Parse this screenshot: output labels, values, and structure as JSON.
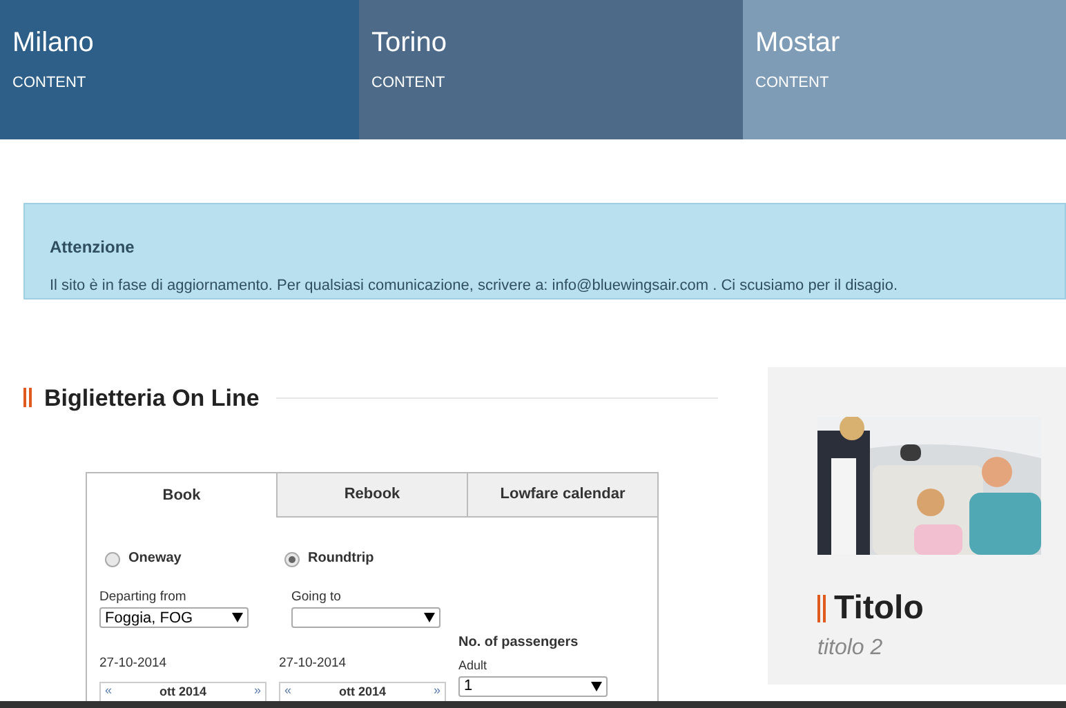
{
  "header_tiles": [
    {
      "title": "Milano",
      "subtitle": "CONTENT",
      "color": "#2e5f88"
    },
    {
      "title": "Torino",
      "subtitle": "CONTENT",
      "color": "#4d6a88"
    },
    {
      "title": "Mostar",
      "subtitle": "CONTENT",
      "color": "#7f9cb7"
    }
  ],
  "alert": {
    "title": "Attenzione",
    "message": "Il sito è in fase di aggiornamento. Per qualsiasi comunicazione, scrivere a: info@bluewingsair.com . Ci scusiamo per il disagio."
  },
  "booking": {
    "heading": "Biglietteria On Line",
    "tabs": [
      {
        "label": "Book",
        "selected": true
      },
      {
        "label": "Rebook",
        "selected": false
      },
      {
        "label": "Lowfare calendar",
        "selected": false
      }
    ],
    "trip_types": [
      {
        "label": "Oneway",
        "selected": false
      },
      {
        "label": "Roundtrip",
        "selected": true
      }
    ],
    "departing": {
      "label": "Departing from",
      "value": "Foggia, FOG"
    },
    "going": {
      "label": "Going to"
    },
    "dates": [
      {
        "date": "27-10-2014",
        "prev": "«",
        "month": "ott 2014",
        "next": "»"
      },
      {
        "date": "27-10-2014",
        "prev": "«",
        "month": "ott 2014",
        "next": "»"
      }
    ],
    "passengers": {
      "heading": "No. of passengers",
      "label": "Adult",
      "value": "1"
    }
  },
  "side_panel": {
    "title": "Titolo",
    "subtitle": "titolo 2"
  }
}
